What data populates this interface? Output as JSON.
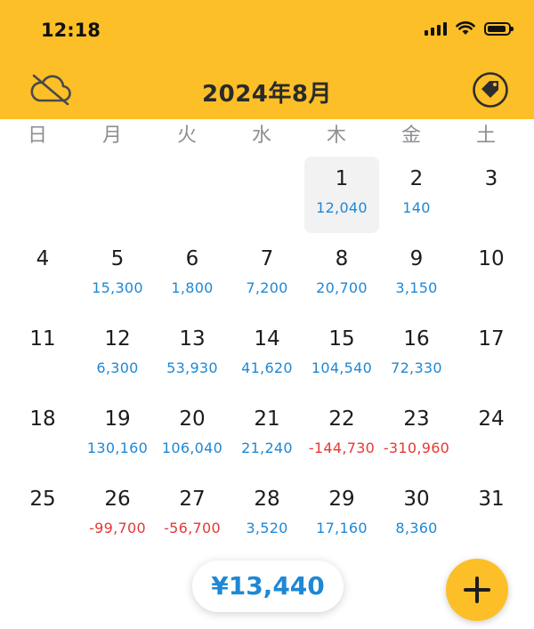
{
  "status": {
    "time": "12:18"
  },
  "header": {
    "title": "2024年8月"
  },
  "weekdays": [
    "日",
    "月",
    "火",
    "水",
    "木",
    "金",
    "土"
  ],
  "calendar": {
    "rows": [
      [
        {
          "day": "",
          "amount": ""
        },
        {
          "day": "",
          "amount": ""
        },
        {
          "day": "",
          "amount": ""
        },
        {
          "day": "",
          "amount": ""
        },
        {
          "day": "1",
          "amount": "12,040",
          "today": true
        },
        {
          "day": "2",
          "amount": "140"
        },
        {
          "day": "3",
          "amount": ""
        }
      ],
      [
        {
          "day": "4",
          "amount": ""
        },
        {
          "day": "5",
          "amount": "15,300"
        },
        {
          "day": "6",
          "amount": "1,800"
        },
        {
          "day": "7",
          "amount": "7,200"
        },
        {
          "day": "8",
          "amount": "20,700"
        },
        {
          "day": "9",
          "amount": "3,150"
        },
        {
          "day": "10",
          "amount": ""
        }
      ],
      [
        {
          "day": "11",
          "amount": ""
        },
        {
          "day": "12",
          "amount": "6,300"
        },
        {
          "day": "13",
          "amount": "53,930"
        },
        {
          "day": "14",
          "amount": "41,620"
        },
        {
          "day": "15",
          "amount": "104,540"
        },
        {
          "day": "16",
          "amount": "72,330"
        },
        {
          "day": "17",
          "amount": ""
        }
      ],
      [
        {
          "day": "18",
          "amount": ""
        },
        {
          "day": "19",
          "amount": "130,160"
        },
        {
          "day": "20",
          "amount": "106,040"
        },
        {
          "day": "21",
          "amount": "21,240"
        },
        {
          "day": "22",
          "amount": "-144,730"
        },
        {
          "day": "23",
          "amount": "-310,960"
        },
        {
          "day": "24",
          "amount": ""
        }
      ],
      [
        {
          "day": "25",
          "amount": ""
        },
        {
          "day": "26",
          "amount": "-99,700"
        },
        {
          "day": "27",
          "amount": "-56,700"
        },
        {
          "day": "28",
          "amount": "3,520"
        },
        {
          "day": "29",
          "amount": "17,160"
        },
        {
          "day": "30",
          "amount": "8,360"
        },
        {
          "day": "31",
          "amount": ""
        }
      ]
    ]
  },
  "footer": {
    "total": "¥13,440"
  },
  "colors": {
    "accent": "#FCBF27",
    "positive": "#1E88D6",
    "negative": "#E53935"
  },
  "icons": {
    "left": "cloud-off-icon",
    "right": "tag-icon",
    "fab": "plus-icon"
  }
}
